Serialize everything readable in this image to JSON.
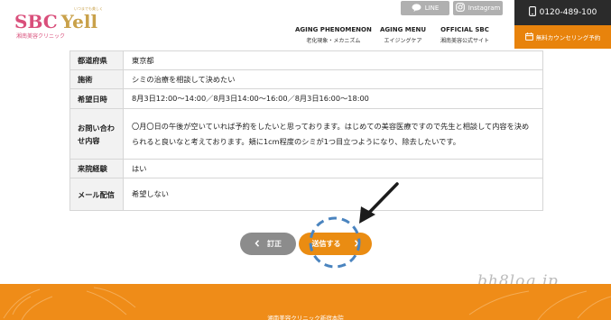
{
  "header": {
    "logo_main": "SBC",
    "logo_yell": "Yell",
    "logo_sub": "湘南美容クリニック",
    "logo_top": "いつまでも美しく",
    "nav": [
      {
        "en": "AGING PHENOMENON",
        "ja": "老化現象・メカニズム"
      },
      {
        "en": "AGING MENU",
        "ja": "エイジングケア"
      },
      {
        "en": "OFFICIAL SBC",
        "ja": "湘南美容公式サイト"
      }
    ],
    "line_label": "LINE",
    "instagram_label": "Instagram",
    "phone": "0120-489-100",
    "counsel_label": "無料カウンセリング予約"
  },
  "form": {
    "rows": [
      {
        "label": "都道府県",
        "value": "東京都"
      },
      {
        "label": "施術",
        "value": "シミの治療を相談して決めたい"
      },
      {
        "label": "希望日時",
        "value": "8月3日12:00～14:00／8月3日14:00～16:00／8月3日16:00～18:00"
      },
      {
        "label": "お問い合わせ内容",
        "value": "〇月〇日の午後が空いていれば予約をしたいと思っております。はじめての美容医療ですので先生と相談して内容を決められると良いなと考えております。頬に1cm程度のシミが1つ目立つようになり、除去したいです。"
      },
      {
        "label": "来院経験",
        "value": "はい"
      },
      {
        "label": "メール配信",
        "value": "希望しない"
      }
    ]
  },
  "buttons": {
    "back_label": "訂正",
    "send_label": "送信する"
  },
  "watermark": "bh8log.jp",
  "footer": {
    "text": "湘南美容クリニック新宿本院"
  },
  "colors": {
    "accent": "#ea8c12",
    "logo_pink": "#d94f7b",
    "annotation_blue": "#4a84bf"
  }
}
